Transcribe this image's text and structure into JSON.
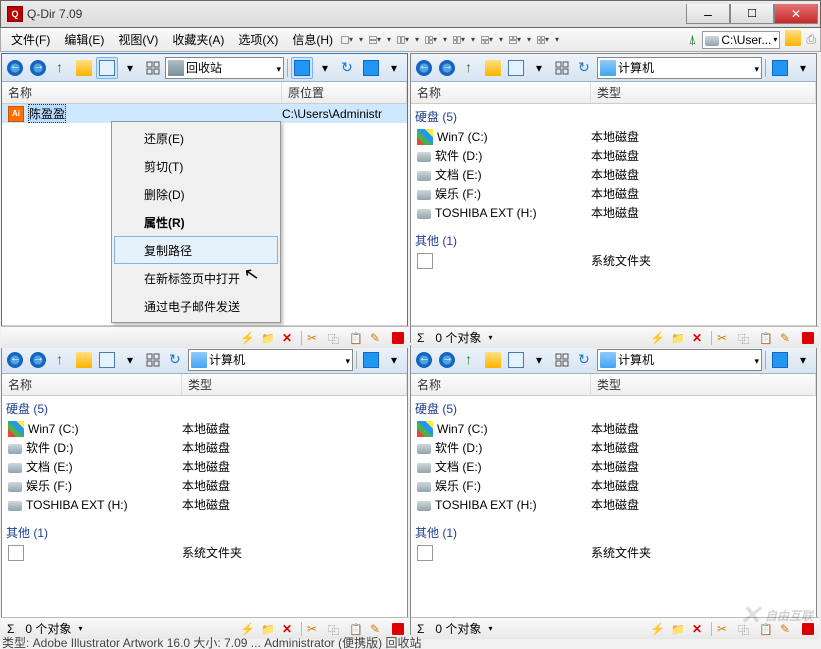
{
  "titlebar": {
    "title": "Q-Dir 7.09"
  },
  "menubar": {
    "items": [
      "文件(F)",
      "编辑(E)",
      "视图(V)",
      "收藏夹(A)",
      "选项(X)",
      "信息(H)"
    ],
    "address_prefix": "C:\\User...",
    "address_dd": "▾"
  },
  "pane_toolbar_labels": {
    "recycle": "回收站",
    "computer": "计算机"
  },
  "columns": {
    "name": "名称",
    "orig": "原位置",
    "type": "类型"
  },
  "pane1": {
    "selected_item": "陈盈盈",
    "orig_value": "C:\\Users\\Administr"
  },
  "groups": {
    "disk": "硬盘 (5)",
    "other": "其他 (1)"
  },
  "drives": [
    {
      "name": "Win7 (C:)",
      "type": "本地磁盘",
      "icon": "win"
    },
    {
      "name": "软件 (D:)",
      "type": "本地磁盘",
      "icon": "drive"
    },
    {
      "name": "文档 (E:)",
      "type": "本地磁盘",
      "icon": "drive"
    },
    {
      "name": "娱乐 (F:)",
      "type": "本地磁盘",
      "icon": "drive"
    },
    {
      "name": "TOSHIBA EXT (H:)",
      "type": "本地磁盘",
      "icon": "drive"
    }
  ],
  "other_item": {
    "name": "",
    "type": "系统文件夹"
  },
  "status": {
    "sigma": "Σ",
    "text": "0 个对象",
    "dd": "▾"
  },
  "context_menu": {
    "items": [
      {
        "label": "还原(E)",
        "bold": false
      },
      {
        "label": "剪切(T)",
        "bold": false
      },
      {
        "label": "删除(D)",
        "bold": false
      },
      {
        "label": "属性(R)",
        "bold": true
      },
      {
        "label": "复制路径",
        "bold": false,
        "hover": true
      },
      {
        "label": "在新标签页中打开",
        "bold": false
      },
      {
        "label": "通过电子邮件发送",
        "bold": false
      }
    ]
  },
  "bottom_text": "类型: Adobe Illustrator Artwork 16.0 大小: 7.09 ...          Administrator (便携版)  回收站",
  "watermark": "自由互联"
}
